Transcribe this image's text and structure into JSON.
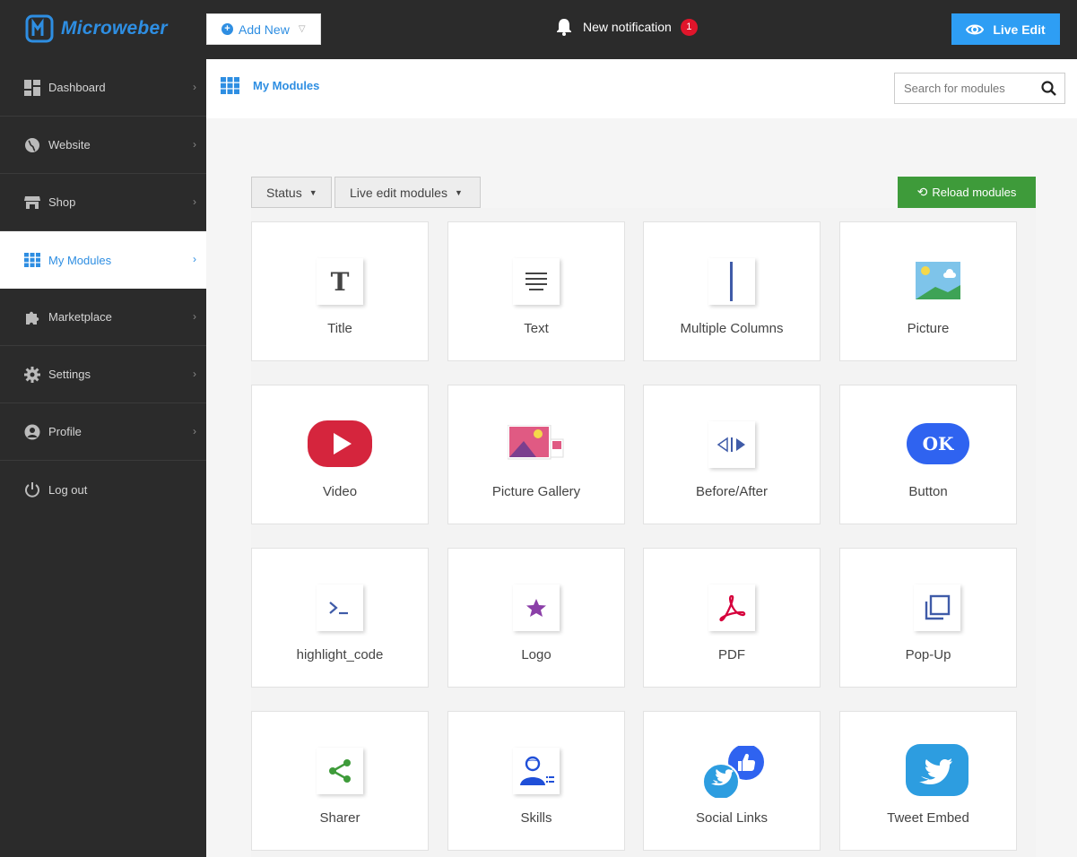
{
  "topbar": {
    "brand": "Microweber",
    "add_new": "Add New",
    "notification": "New notification",
    "notification_count": "1",
    "live_edit": "Live Edit"
  },
  "sidebar": {
    "items": [
      {
        "label": "Dashboard"
      },
      {
        "label": "Website"
      },
      {
        "label": "Shop"
      },
      {
        "label": "My Modules"
      },
      {
        "label": "Marketplace"
      },
      {
        "label": "Settings"
      },
      {
        "label": "Profile"
      },
      {
        "label": "Log out"
      }
    ]
  },
  "header": {
    "title": "My Modules",
    "search_placeholder": "Search for modules"
  },
  "filters": {
    "status": "Status",
    "live_edit_modules": "Live edit modules",
    "reload": "Reload modules"
  },
  "modules": [
    {
      "label": "Title",
      "icon": "title-icon"
    },
    {
      "label": "Text",
      "icon": "text-icon"
    },
    {
      "label": "Multiple Columns",
      "icon": "columns-icon"
    },
    {
      "label": "Picture",
      "icon": "picture-icon"
    },
    {
      "label": "Video",
      "icon": "video-icon"
    },
    {
      "label": "Picture Gallery",
      "icon": "gallery-icon"
    },
    {
      "label": "Before/After",
      "icon": "before-after-icon"
    },
    {
      "label": "Button",
      "icon": "button-icon"
    },
    {
      "label": "highlight_code",
      "icon": "code-icon"
    },
    {
      "label": "Logo",
      "icon": "logo-icon"
    },
    {
      "label": "PDF",
      "icon": "pdf-icon"
    },
    {
      "label": "Pop-Up",
      "icon": "popup-icon"
    },
    {
      "label": "Sharer",
      "icon": "share-icon"
    },
    {
      "label": "Skills",
      "icon": "skills-icon"
    },
    {
      "label": "Social Links",
      "icon": "social-links-icon"
    },
    {
      "label": "Tweet Embed",
      "icon": "twitter-icon"
    }
  ],
  "button_icon_text": "OK",
  "colors": {
    "brand": "#2e8ee2",
    "topbar": "#2b2b2b",
    "live_edit": "#2e9ef4",
    "reload": "#3e9b3a",
    "badge": "#e0152b"
  }
}
